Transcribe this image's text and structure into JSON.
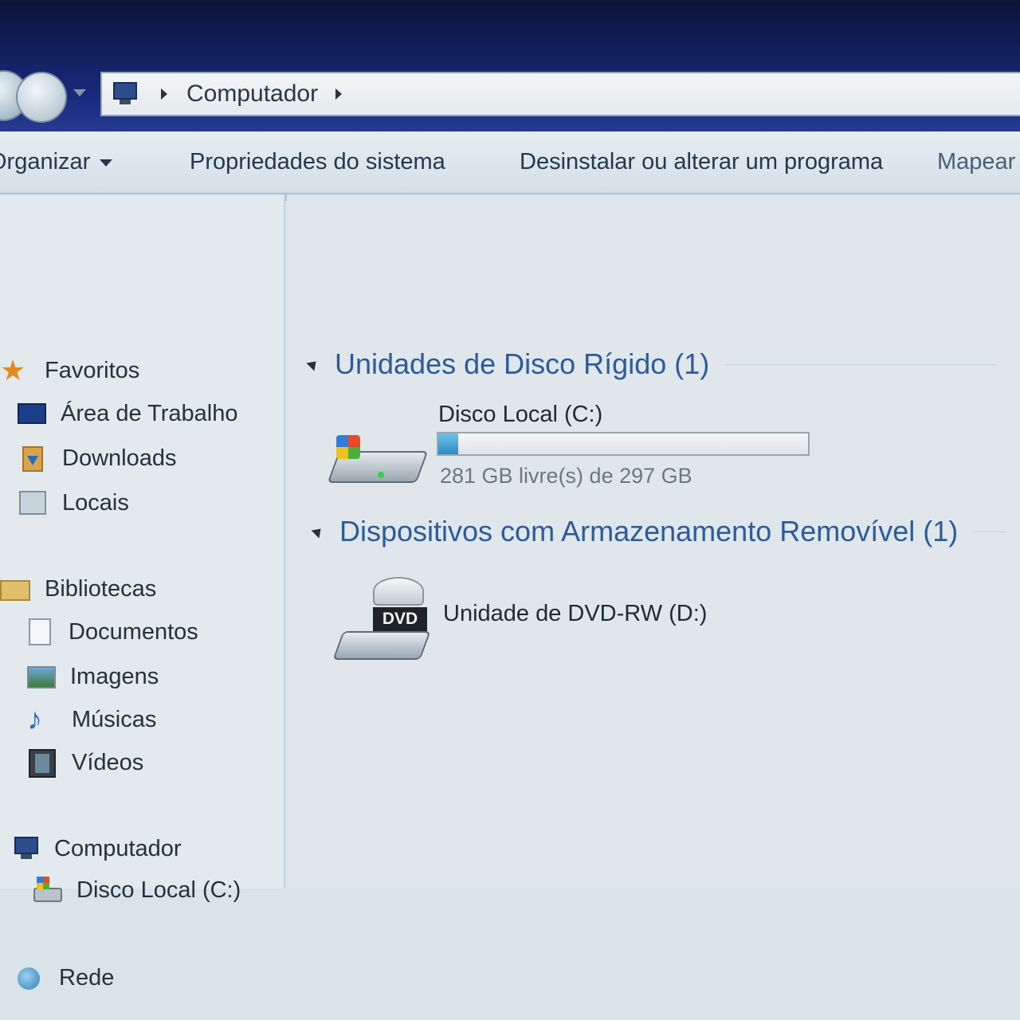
{
  "address_bar": {
    "icon": "computer-icon",
    "crumb": "Computador"
  },
  "toolbar": {
    "organize": "Organizar",
    "system_properties": "Propriedades do sistema",
    "uninstall": "Desinstalar ou alterar um programa",
    "map_drive": "Mapear"
  },
  "nav": {
    "favorites": {
      "label": "Favoritos",
      "items": [
        {
          "label": "Área de Trabalho",
          "icon": "desktop-icon"
        },
        {
          "label": "Downloads",
          "icon": "downloads-icon"
        },
        {
          "label": "Locais",
          "icon": "recent-places-icon"
        }
      ]
    },
    "libraries": {
      "label": "Bibliotecas",
      "items": [
        {
          "label": "Documentos",
          "icon": "documents-icon"
        },
        {
          "label": "Imagens",
          "icon": "pictures-icon"
        },
        {
          "label": "Músicas",
          "icon": "music-icon"
        },
        {
          "label": "Vídeos",
          "icon": "videos-icon"
        }
      ]
    },
    "computer": {
      "label": "Computador",
      "items": [
        {
          "label": "Disco Local (C:)",
          "icon": "local-disk-icon"
        }
      ]
    },
    "network": {
      "label": "Rede"
    }
  },
  "content": {
    "hard_drives_group": "Unidades de Disco Rígido (1)",
    "removable_group": "Dispositivos com Armazenamento Removível (1)",
    "drive_c": {
      "name": "Disco Local (C:)",
      "free_text": "281 GB livre(s) de 297 GB",
      "used_fraction": 0.054
    },
    "drive_d": {
      "name": "Unidade de DVD-RW (D:)",
      "badge": "DVD"
    }
  },
  "colors": {
    "group_title": "#2f5a9a",
    "usage_bar": "#2b8cc4"
  }
}
